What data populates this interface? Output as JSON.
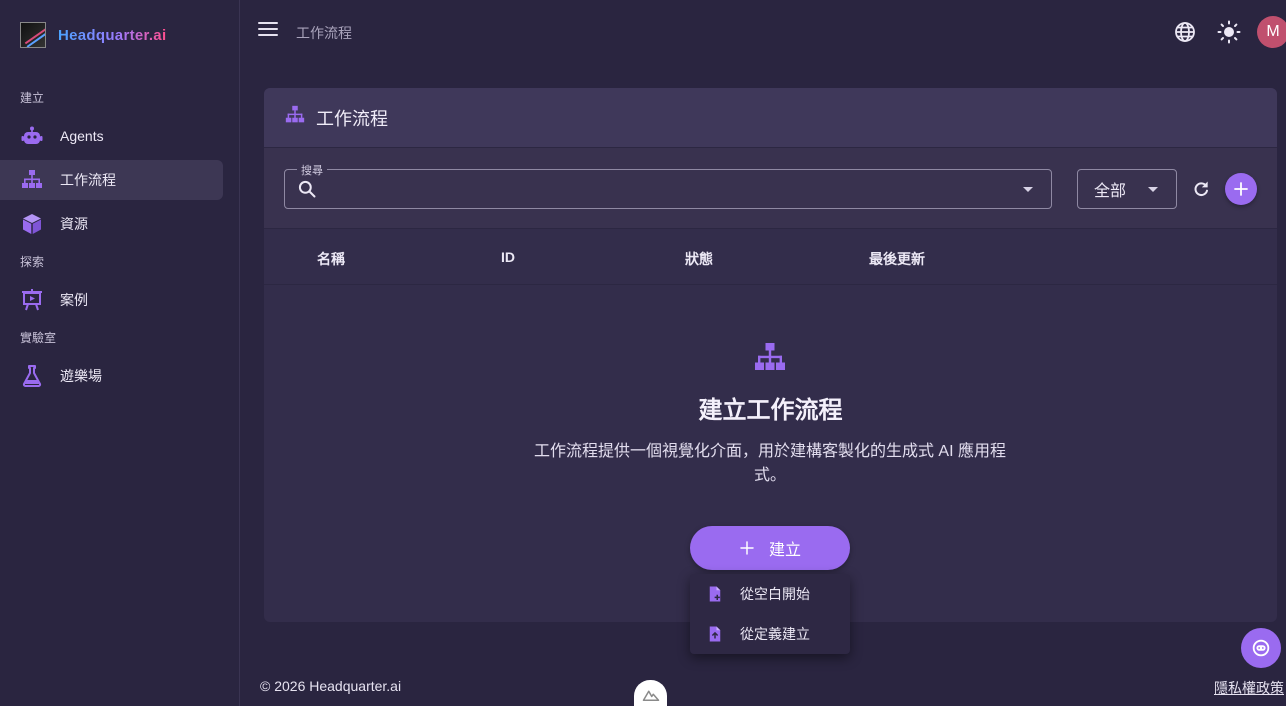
{
  "brand": {
    "name": "Headquarter.ai"
  },
  "sidebar": {
    "sections": [
      {
        "label": "建立"
      },
      {
        "label": "探索"
      },
      {
        "label": "實驗室"
      }
    ],
    "items": [
      {
        "label": "Agents",
        "icon": "robot-icon"
      },
      {
        "label": "工作流程",
        "icon": "sitemap-icon",
        "active": true
      },
      {
        "label": "資源",
        "icon": "cube-icon"
      },
      {
        "label": "案例",
        "icon": "presentation-icon"
      },
      {
        "label": "遊樂場",
        "icon": "flask-icon"
      }
    ]
  },
  "topbar": {
    "breadcrumb": "工作流程",
    "avatar_initial": "M"
  },
  "card": {
    "title": "工作流程",
    "search": {
      "legend": "搜尋",
      "value": ""
    },
    "filter": {
      "selected": "全部"
    },
    "columns": [
      "名稱",
      "ID",
      "狀態",
      "最後更新"
    ],
    "empty": {
      "title": "建立工作流程",
      "description": "工作流程提供一個視覺化介面，用於建構客製化的生成式 AI 應用程式。",
      "create_label": "建立"
    }
  },
  "menu": {
    "items": [
      {
        "label": "從空白開始",
        "icon": "file-plus-icon"
      },
      {
        "label": "從定義建立",
        "icon": "file-upload-icon"
      }
    ]
  },
  "footer": {
    "copyright": "© 2026 Headquarter.ai",
    "privacy": "隱私權政策"
  },
  "colors": {
    "accent": "#9a6bf0",
    "background": "#2a2540",
    "card": "#332d4b",
    "avatar": "#c0506e"
  }
}
